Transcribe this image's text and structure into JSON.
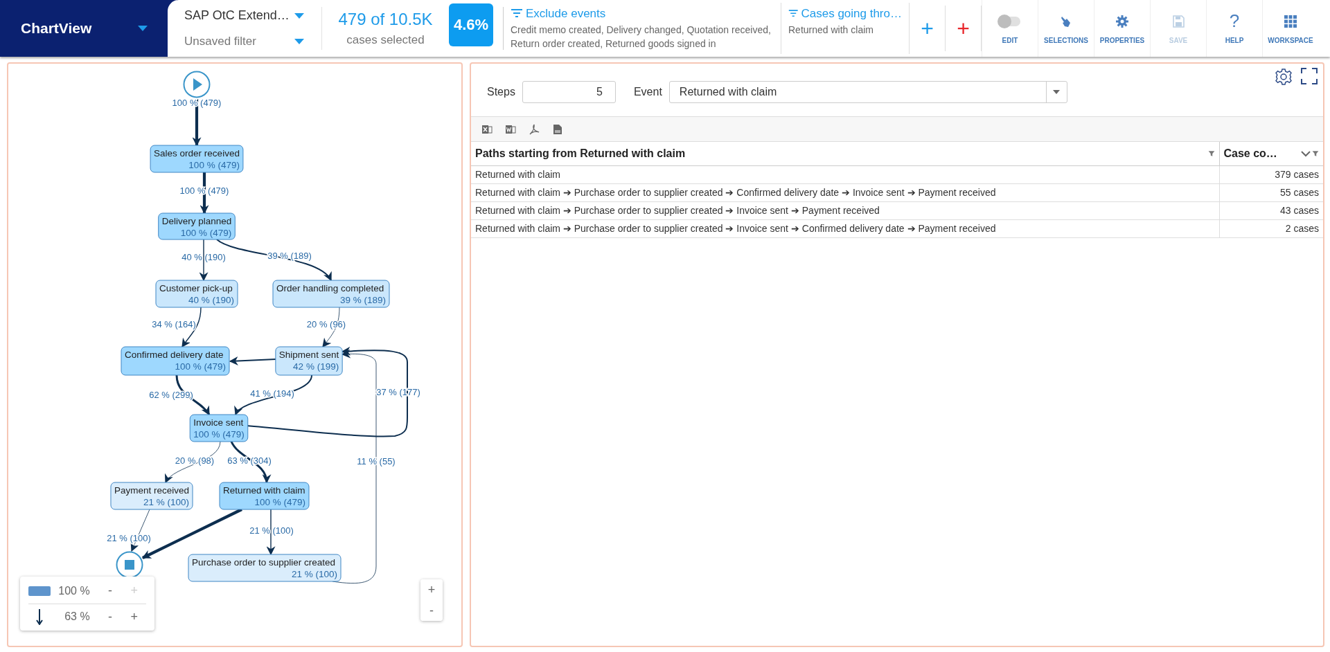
{
  "app": {
    "title": "ChartView"
  },
  "dataset": {
    "name": "SAP OtC Extend…",
    "filter": "Unsaved filter"
  },
  "selection": {
    "count": "479 of 10.5K",
    "caption": "cases selected",
    "share": "4.6%"
  },
  "filters": [
    {
      "title": "Exclude events",
      "description": "Credit memo created, Delivery changed, Quotation received, Return order created, Returned goods signed in"
    },
    {
      "title": "Cases going thro…",
      "description": "Returned with claim"
    }
  ],
  "add_buttons": [
    {
      "label": "+",
      "color": "#1e9be9"
    },
    {
      "label": "+",
      "color": "#e8262b"
    }
  ],
  "toolbar": [
    {
      "kind": "toggle",
      "label": "EDIT",
      "on": false,
      "disabled": false
    },
    {
      "kind": "selections",
      "label": "SELECTIONS",
      "disabled": false
    },
    {
      "kind": "properties",
      "label": "PROPERTIES",
      "disabled": false
    },
    {
      "kind": "save",
      "label": "SAVE",
      "disabled": true
    },
    {
      "kind": "help",
      "label": "HELP",
      "glyph": "?",
      "disabled": false
    },
    {
      "kind": "workspace",
      "label": "WORKSPACE",
      "disabled": false
    }
  ],
  "diagram": {
    "nodes": [
      {
        "kind": "start"
      },
      {
        "kind": "activity",
        "name": "Sales order received",
        "stat": "100 % (479)",
        "color": "#9ed8fe"
      },
      {
        "kind": "activity",
        "name": "Delivery planned",
        "stat": "100 % (479)",
        "color": "#9ed8fe"
      },
      {
        "kind": "activity",
        "name": "Customer pick-up",
        "stat": "40 % (190)",
        "color": "#cae7fc"
      },
      {
        "kind": "activity",
        "name": "Order handling completed",
        "stat": "39 % (189)",
        "color": "#cae7fc"
      },
      {
        "kind": "activity",
        "name": "Confirmed delivery date",
        "stat": "100 % (479)",
        "color": "#9ed8fe"
      },
      {
        "kind": "activity",
        "name": "Shipment sent",
        "stat": "42 % (199)",
        "color": "#cae7fc"
      },
      {
        "kind": "activity",
        "name": "Invoice sent",
        "stat": "100 % (479)",
        "color": "#9ed8fe"
      },
      {
        "kind": "activity",
        "name": "Payment received",
        "stat": "21 % (100)",
        "color": "#daedfc"
      },
      {
        "kind": "activity",
        "name": "Returned with claim",
        "stat": "100 % (479)",
        "color": "#9ed8fe"
      },
      {
        "kind": "activity",
        "name": "Purchase order to supplier created",
        "stat": "21 % (100)",
        "color": "#daedfc"
      },
      {
        "kind": "end"
      }
    ],
    "edges": [
      {
        "label": "100 % (479)",
        "kind": "heavy"
      },
      {
        "label": "100 % (479)",
        "kind": "heavy"
      },
      {
        "label": "40 % (190)",
        "kind": "light"
      },
      {
        "label": "39 % (189)",
        "kind": "medium"
      },
      {
        "label": "34 % (164)",
        "kind": "light"
      },
      {
        "label": "20 % (96)",
        "kind": "hairline"
      },
      {
        "kind": "medium"
      },
      {
        "label": "62 % (299)",
        "kind": "strong"
      },
      {
        "label": "41 % (194)",
        "kind": "medium"
      },
      {
        "label": "37 % (177)",
        "kind": "medium"
      },
      {
        "label": "20 % (98)",
        "kind": "hairline"
      },
      {
        "label": "63 % (304)",
        "kind": "strong"
      },
      {
        "label": "21 % (100)",
        "kind": "hairline"
      },
      {
        "kind": "heavy"
      },
      {
        "label": "21 % (100)",
        "kind": "light"
      },
      {
        "label": "11 % (55)",
        "kind": "hairline"
      }
    ],
    "legend": [
      {
        "kind": "activities",
        "value": "100 %",
        "minus": "-",
        "plus": "+",
        "minus_disabled": false,
        "plus_disabled": true
      },
      {
        "kind": "paths",
        "value": "63 %",
        "minus": "-",
        "plus": "+",
        "minus_disabled": false,
        "plus_disabled": false
      }
    ],
    "zoom_controls": [
      "+",
      "-"
    ]
  },
  "path_settings": {
    "steps_label": "Steps",
    "steps": "5",
    "event_label": "Event",
    "event": "Returned with claim"
  },
  "export": [
    {
      "kind": "excel"
    },
    {
      "kind": "word"
    },
    {
      "kind": "pdf"
    },
    {
      "kind": "csv"
    }
  ],
  "table": {
    "columns": [
      {
        "title": "Paths starting from Returned with claim",
        "sorted": false
      },
      {
        "title": "Case co…",
        "sorted": true
      }
    ],
    "rows": [
      {
        "path": "Returned with claim",
        "cases": "379 cases"
      },
      {
        "path": "Returned with claim ➔ Purchase order to supplier created ➔ Confirmed delivery date ➔ Invoice sent ➔ Payment received",
        "cases": "55 cases"
      },
      {
        "path": "Returned with claim ➔ Purchase order to supplier created ➔ Invoice sent ➔ Payment received",
        "cases": "43 cases"
      },
      {
        "path": "Returned with claim ➔ Purchase order to supplier created ➔ Invoice sent ➔ Confirmed delivery date ➔ Payment received",
        "cases": "2 cases"
      }
    ]
  }
}
